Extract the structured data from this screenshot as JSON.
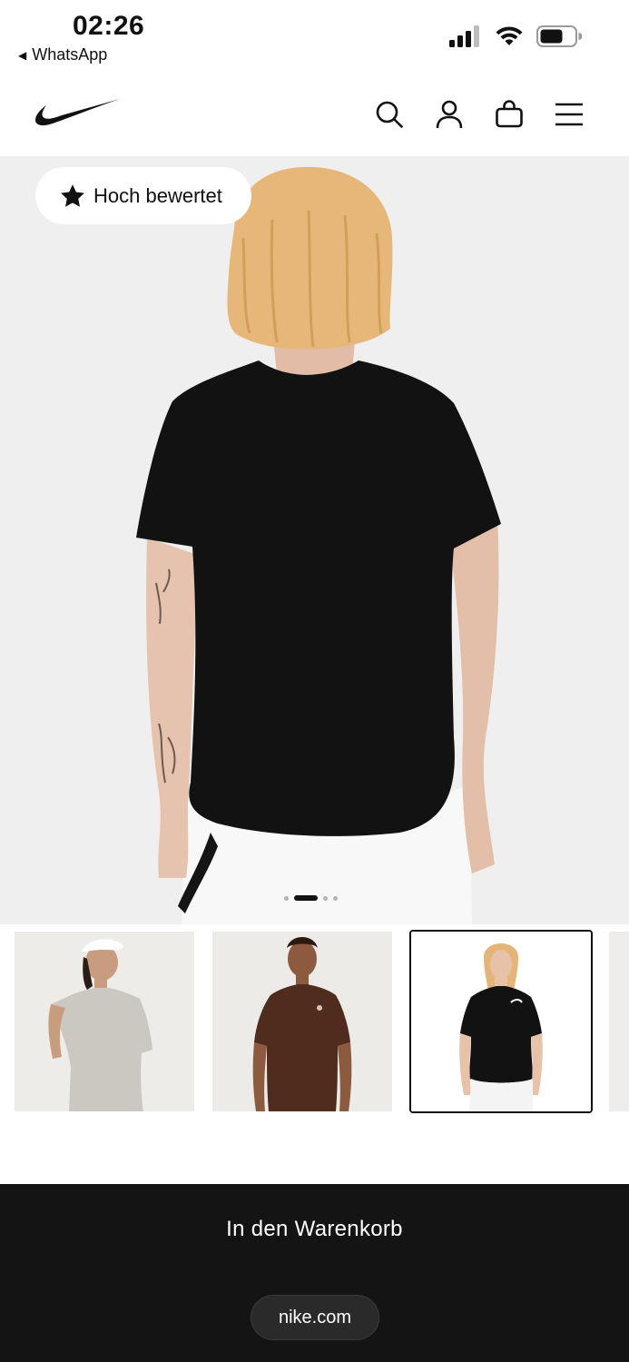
{
  "status_bar": {
    "time": "02:26",
    "back_app": "WhatsApp",
    "icons": [
      "cellular-signal-icon",
      "wifi-icon",
      "battery-icon"
    ]
  },
  "header": {
    "logo": "nike-swoosh-logo",
    "icons": [
      "search-icon",
      "account-icon",
      "bag-icon",
      "menu-icon"
    ]
  },
  "hero": {
    "badge_label": "Hoch bewertet",
    "badge_icon": "star-icon",
    "image": "woman-black-tshirt-back-view",
    "carousel": {
      "total": 4,
      "active_index": 1
    }
  },
  "thumbnails": [
    {
      "description": "grey tshirt with white cap",
      "shirt_color": "#cbc7c1",
      "selected": false
    },
    {
      "description": "brown tshirt",
      "shirt_color": "#4f2c1e",
      "selected": false
    },
    {
      "description": "black tshirt",
      "shirt_color": "#121212",
      "selected": true
    }
  ],
  "footer": {
    "add_to_cart_label": "In den Warenkorb",
    "url": "nike.com"
  },
  "colors": {
    "brand_black": "#111111",
    "hero_bg": "#efefef",
    "bottom_bar": "#141414"
  }
}
